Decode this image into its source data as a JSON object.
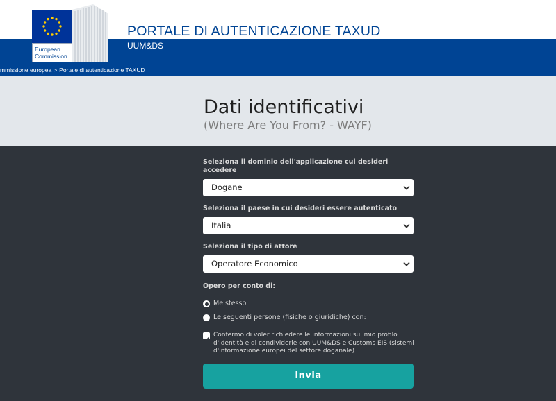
{
  "header": {
    "logo_label_line1": "European",
    "logo_label_line2": "Commission",
    "title": "PORTALE DI AUTENTICAZIONE TAXUD",
    "subtitle": "UUM&DS"
  },
  "breadcrumb": {
    "items": [
      "mmissione europea",
      "Portale di autenticazione TAXUD"
    ],
    "separator": ">"
  },
  "page": {
    "title": "Dati identificativi",
    "subtitle": "(Where Are You From? - WAYF)"
  },
  "form": {
    "domain": {
      "label": "Seleziona il dominio dell'applicazione cui desideri accedere",
      "value": "Dogane"
    },
    "country": {
      "label": "Seleziona il paese in cui desideri essere autenticato",
      "value": "Italia"
    },
    "actor": {
      "label": "Seleziona il tipo di attore",
      "value": "Operatore Economico"
    },
    "on_behalf": {
      "label": "Opero per conto di:",
      "options": [
        {
          "label": "Me stesso",
          "checked": true
        },
        {
          "label": "Le seguenti persone (fisiche o giuridiche) con:",
          "checked": false
        }
      ]
    },
    "consent": {
      "checked": true,
      "text": "Confermo di voler richiedere le informazioni sul mio profilo d'identità e di condividerle con UUM&DS e Customs EIS (sistemi d'informazione europei del settore doganale)"
    },
    "submit_label": "Invia"
  },
  "colors": {
    "brand_blue": "#004494",
    "heading_bg": "#e3e7eb",
    "form_bg": "#2f343b",
    "accent_teal": "#17a2a0"
  }
}
